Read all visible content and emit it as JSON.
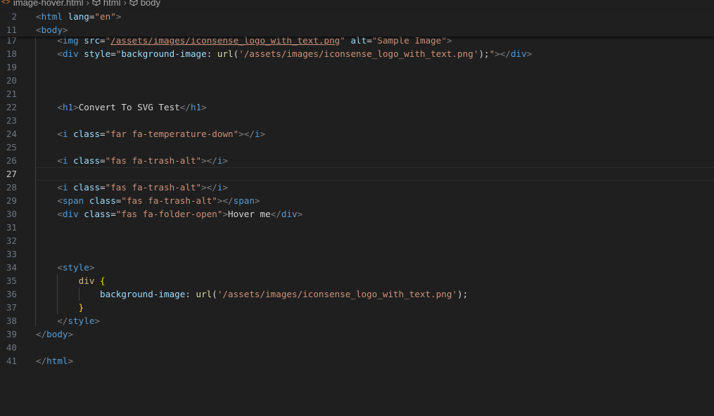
{
  "breadcrumb": {
    "file": "image-hover.html",
    "items": [
      "html",
      "body"
    ]
  },
  "sticky_lines": [
    {
      "num": "2",
      "parts": [
        [
          "t",
          "<"
        ],
        [
          "tg",
          "html"
        ],
        [
          "tx",
          " "
        ],
        [
          "at",
          "lang"
        ],
        [
          "tx",
          "="
        ],
        [
          "st",
          "\"en\""
        ],
        [
          "t",
          ">"
        ]
      ]
    },
    {
      "num": "11",
      "parts": [
        [
          "t",
          "<"
        ],
        [
          "tg",
          "body"
        ],
        [
          "t",
          ">"
        ]
      ]
    }
  ],
  "lines": [
    {
      "num": "17",
      "parts": [
        [
          "tx",
          "    "
        ],
        [
          "t",
          "<"
        ],
        [
          "tg",
          "img"
        ],
        [
          "tx",
          " "
        ],
        [
          "at",
          "src"
        ],
        [
          "tx",
          "="
        ],
        [
          "st",
          "\""
        ],
        [
          "stu",
          "/assets/images/iconsense_logo_with_text.png"
        ],
        [
          "st",
          "\""
        ],
        [
          "tx",
          " "
        ],
        [
          "at",
          "alt"
        ],
        [
          "tx",
          "="
        ],
        [
          "st",
          "\"Sample Image\""
        ],
        [
          "t",
          ">"
        ]
      ]
    },
    {
      "num": "18",
      "parts": [
        [
          "tx",
          "    "
        ],
        [
          "t",
          "<"
        ],
        [
          "tg",
          "div"
        ],
        [
          "tx",
          " "
        ],
        [
          "at",
          "style"
        ],
        [
          "tx",
          "="
        ],
        [
          "st",
          "\""
        ],
        [
          "pr",
          "background-image"
        ],
        [
          "tx",
          ": "
        ],
        [
          "fn",
          "url"
        ],
        [
          "tx",
          "("
        ],
        [
          "st",
          "'/assets/images/iconsense_logo_with_text.png'"
        ],
        [
          "tx",
          ");"
        ],
        [
          "st",
          "\""
        ],
        [
          "t",
          "></"
        ],
        [
          "tg",
          "div"
        ],
        [
          "t",
          ">"
        ]
      ]
    },
    {
      "num": "19",
      "parts": []
    },
    {
      "num": "20",
      "parts": []
    },
    {
      "num": "21",
      "parts": []
    },
    {
      "num": "22",
      "parts": [
        [
          "tx",
          "    "
        ],
        [
          "t",
          "<"
        ],
        [
          "tg",
          "h1"
        ],
        [
          "t",
          ">"
        ],
        [
          "tx",
          "Convert To SVG Test"
        ],
        [
          "t",
          "</"
        ],
        [
          "tg",
          "h1"
        ],
        [
          "t",
          ">"
        ]
      ]
    },
    {
      "num": "23",
      "parts": []
    },
    {
      "num": "24",
      "parts": [
        [
          "tx",
          "    "
        ],
        [
          "t",
          "<"
        ],
        [
          "tg",
          "i"
        ],
        [
          "tx",
          " "
        ],
        [
          "at",
          "class"
        ],
        [
          "tx",
          "="
        ],
        [
          "st",
          "\"far fa-temperature-down\""
        ],
        [
          "t",
          "></"
        ],
        [
          "tg",
          "i"
        ],
        [
          "t",
          ">"
        ]
      ]
    },
    {
      "num": "25",
      "parts": []
    },
    {
      "num": "26",
      "parts": [
        [
          "tx",
          "    "
        ],
        [
          "t",
          "<"
        ],
        [
          "tg",
          "i"
        ],
        [
          "tx",
          " "
        ],
        [
          "at",
          "class"
        ],
        [
          "tx",
          "="
        ],
        [
          "st",
          "\"fas fa-trash-alt\""
        ],
        [
          "t",
          "></"
        ],
        [
          "tg",
          "i"
        ],
        [
          "t",
          ">"
        ]
      ]
    },
    {
      "num": "27",
      "parts": [],
      "active": true
    },
    {
      "num": "28",
      "parts": [
        [
          "tx",
          "    "
        ],
        [
          "t",
          "<"
        ],
        [
          "tg",
          "i"
        ],
        [
          "tx",
          " "
        ],
        [
          "at",
          "class"
        ],
        [
          "tx",
          "="
        ],
        [
          "st",
          "\"fas fa-trash-alt\""
        ],
        [
          "t",
          "></"
        ],
        [
          "tg",
          "i"
        ],
        [
          "t",
          ">"
        ]
      ]
    },
    {
      "num": "29",
      "parts": [
        [
          "tx",
          "    "
        ],
        [
          "t",
          "<"
        ],
        [
          "tg",
          "span"
        ],
        [
          "tx",
          " "
        ],
        [
          "at",
          "class"
        ],
        [
          "tx",
          "="
        ],
        [
          "st",
          "\"fas fa-trash-alt\""
        ],
        [
          "t",
          "></"
        ],
        [
          "tg",
          "span"
        ],
        [
          "t",
          ">"
        ]
      ]
    },
    {
      "num": "30",
      "parts": [
        [
          "tx",
          "    "
        ],
        [
          "t",
          "<"
        ],
        [
          "tg",
          "div"
        ],
        [
          "tx",
          " "
        ],
        [
          "at",
          "class"
        ],
        [
          "tx",
          "="
        ],
        [
          "st",
          "\"fas fa-folder-open\""
        ],
        [
          "t",
          ">"
        ],
        [
          "tx",
          "Hover me"
        ],
        [
          "t",
          "</"
        ],
        [
          "tg",
          "div"
        ],
        [
          "t",
          ">"
        ]
      ]
    },
    {
      "num": "31",
      "parts": []
    },
    {
      "num": "32",
      "parts": []
    },
    {
      "num": "33",
      "parts": []
    },
    {
      "num": "34",
      "parts": [
        [
          "tx",
          "    "
        ],
        [
          "t",
          "<"
        ],
        [
          "tg",
          "style"
        ],
        [
          "t",
          ">"
        ]
      ]
    },
    {
      "num": "35",
      "parts": [
        [
          "tx",
          "        "
        ],
        [
          "sel",
          "div"
        ],
        [
          "tx",
          " "
        ],
        [
          "br",
          "{"
        ]
      ]
    },
    {
      "num": "36",
      "parts": [
        [
          "tx",
          "            "
        ],
        [
          "pr",
          "background-image"
        ],
        [
          "tx",
          ": "
        ],
        [
          "fn",
          "url"
        ],
        [
          "tx",
          "("
        ],
        [
          "st",
          "'/assets/images/iconsense_logo_with_text.png'"
        ],
        [
          "tx",
          ");"
        ]
      ]
    },
    {
      "num": "37",
      "parts": [
        [
          "tx",
          "        "
        ],
        [
          "br",
          "}"
        ]
      ]
    },
    {
      "num": "38",
      "parts": [
        [
          "tx",
          "    "
        ],
        [
          "t",
          "</"
        ],
        [
          "tg",
          "style"
        ],
        [
          "t",
          ">"
        ]
      ]
    },
    {
      "num": "39",
      "parts": [
        [
          "t",
          "</"
        ],
        [
          "tg",
          "body"
        ],
        [
          "t",
          ">"
        ]
      ]
    },
    {
      "num": "40",
      "parts": []
    },
    {
      "num": "41",
      "parts": [
        [
          "t",
          "</"
        ],
        [
          "tg",
          "html"
        ],
        [
          "t",
          ">"
        ]
      ]
    }
  ]
}
